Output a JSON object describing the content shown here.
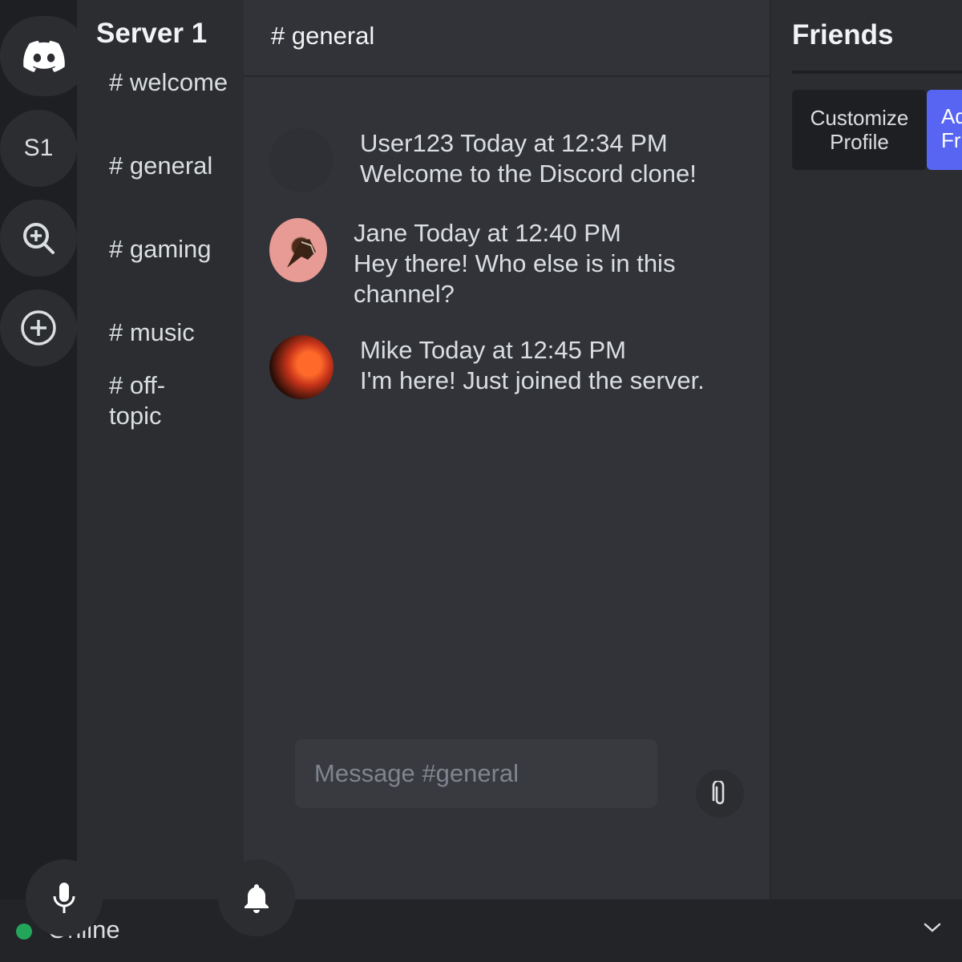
{
  "server_rail": {
    "s1_label": "S1"
  },
  "channel_panel": {
    "server_name": "Server 1",
    "channels": [
      "# welcome",
      "# general",
      "# gaming",
      "# music",
      "# off-topic"
    ]
  },
  "chat": {
    "title": "# general",
    "messages": [
      {
        "header": "User123 Today at 12:34 PM",
        "body": "Welcome to the Discord clone!"
      },
      {
        "header": "Jane Today at 12:40 PM",
        "body": "Hey there! Who else is in this channel?"
      },
      {
        "header": "Mike Today at 12:45 PM",
        "body": "I'm here! Just joined the server."
      }
    ],
    "composer_placeholder": "Message #general"
  },
  "friends": {
    "title": "Friends",
    "customize_label": "Customize Profile",
    "add_label": "Add Friend"
  },
  "status": {
    "text": "Online",
    "color": "#23a55a"
  },
  "colors": {
    "accent": "#5865f2",
    "rail_bg": "#1e1f22",
    "panel_bg": "#2b2d31",
    "chat_bg": "#313338"
  }
}
